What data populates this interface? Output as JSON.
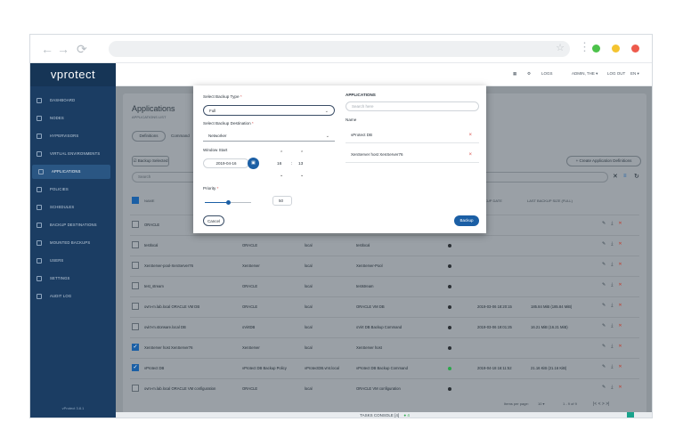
{
  "browser": {
    "back": "←",
    "forward": "→",
    "reload": "⟳",
    "star": "☆",
    "menu": "⋮",
    "traffic_colors": [
      "#4cc24a",
      "#f4c430",
      "#ee5a4c"
    ]
  },
  "app": {
    "logo": "vprotect",
    "version": "vProtect 3.8.1"
  },
  "sidebar": {
    "items": [
      {
        "label": "DASHBOARD",
        "icon": "dashboard-icon"
      },
      {
        "label": "NODES",
        "icon": "nodes-icon"
      },
      {
        "label": "HYPERVISORS",
        "icon": "hypervisors-icon"
      },
      {
        "label": "VIRTUAL ENVIRONMENTS",
        "icon": "virtual-env-icon"
      },
      {
        "label": "APPLICATIONS",
        "icon": "applications-icon",
        "active": true
      },
      {
        "label": "POLICIES",
        "icon": "policies-icon"
      },
      {
        "label": "SCHEDULES",
        "icon": "schedules-icon"
      },
      {
        "label": "BACKUP DESTINATIONS",
        "icon": "backup-destinations-icon"
      },
      {
        "label": "MOUNTED BACKUPS",
        "icon": "mounted-backups-icon"
      },
      {
        "label": "USERS",
        "icon": "users-icon"
      },
      {
        "label": "SETTINGS",
        "icon": "settings-icon"
      },
      {
        "label": "AUDIT LOG",
        "icon": "audit-log-icon"
      }
    ]
  },
  "topbar": {
    "logs": "LOGS",
    "user": "ADMIN, THE ▾",
    "logout": "LOG OUT",
    "lang": "EN ▾"
  },
  "page": {
    "title": "Applications",
    "subtitle": "APPLICATIONS LIST",
    "tab_definitions": "Definitions",
    "tab_commands": "Command",
    "backup_selected": "☑ Backup Selected",
    "create_definition": "+ Create Application Definitions",
    "search_placeholder": "Search",
    "columns": {
      "name": "NAME",
      "last_backup_date": "BACKUP DATE",
      "last_backup_size": "LAST BACKUP SIZE (FULL)"
    }
  },
  "rows": [
    {
      "name": "ORACLE",
      "type": "",
      "node": "",
      "cmd": "",
      "status": "",
      "date": "",
      "size": "",
      "checked": false
    },
    {
      "name": "testlocal",
      "type": "ORACLE",
      "node": "local",
      "cmd": "testlocal",
      "status": "dark",
      "date": "",
      "size": "",
      "checked": false
    },
    {
      "name": "XenServer-pool-XenServer76",
      "type": "XenServer",
      "node": "local",
      "cmd": "XenServer-Pool",
      "status": "dark",
      "date": "",
      "size": "",
      "checked": false
    },
    {
      "name": "test_stream",
      "type": "ORACLE",
      "node": "local",
      "cmd": "teststream",
      "status": "dark",
      "date": "",
      "size": "",
      "checked": false
    },
    {
      "name": "ovm-m.lab.local ORACLE VM DB",
      "type": "ORACLE",
      "node": "local",
      "cmd": "ORACLE VM DB",
      "status": "dark",
      "date": "2019-03-06 18:20:15",
      "size": "185.84 MiB (185.84 MiB)",
      "checked": false
    },
    {
      "name": "ovirt-m.storware.local DB",
      "type": "oVirtDB",
      "node": "local",
      "cmd": "oVirt DB Backup Command",
      "status": "dark",
      "date": "2019-03-06 19:01:25",
      "size": "16.21 MiB (16.21 MiB)",
      "checked": false
    },
    {
      "name": "XenServer host XenServer76",
      "type": "XenServer",
      "node": "local",
      "cmd": "XenServer host",
      "status": "dark",
      "date": "",
      "size": "",
      "checked": true
    },
    {
      "name": "vProtect DB",
      "type": "vProtect DB Backup Policy",
      "node": "vProtectDB.vmt.local",
      "cmd": "vProtect DB Backup Command",
      "status": "green",
      "date": "2019-04-18 16:11:52",
      "size": "21.16 KiB (21.16 KiB)",
      "checked": true
    },
    {
      "name": "ovm-m.lab.local ORACLE VM configuration",
      "type": "ORACLE",
      "node": "local",
      "cmd": "ORACLE VM configuration",
      "status": "dark",
      "date": "",
      "size": "",
      "checked": false
    }
  ],
  "footer": {
    "items_per_page_label": "Items per page:",
    "items_per_page": "10 ▾",
    "range": "1 - 9 of 9",
    "pager": "|<   <   >   >|"
  },
  "taskbar": {
    "label": "TASKS CONSOLE [4]",
    "count": "● 4"
  },
  "modal": {
    "backup_type_label": "Select Backup Type",
    "backup_type_value": "Full",
    "destination_label": "Select Backup Destination",
    "destination_value": "Networker",
    "window_start_label": "Window Start",
    "date_value": "2019-04-16",
    "hour": "16",
    "minute": "13",
    "time_sep": ":",
    "priority_label": "Priority",
    "priority_value": "50",
    "cancel": "Cancel",
    "backup": "Backup",
    "apps_title": "APPLICATIONS",
    "apps_search_placeholder": "Search here",
    "apps_name_header": "Name",
    "apps": [
      "vProtect DB",
      "XenServer host XenServer76"
    ],
    "remove_glyph": "×",
    "required_mark": "*"
  }
}
